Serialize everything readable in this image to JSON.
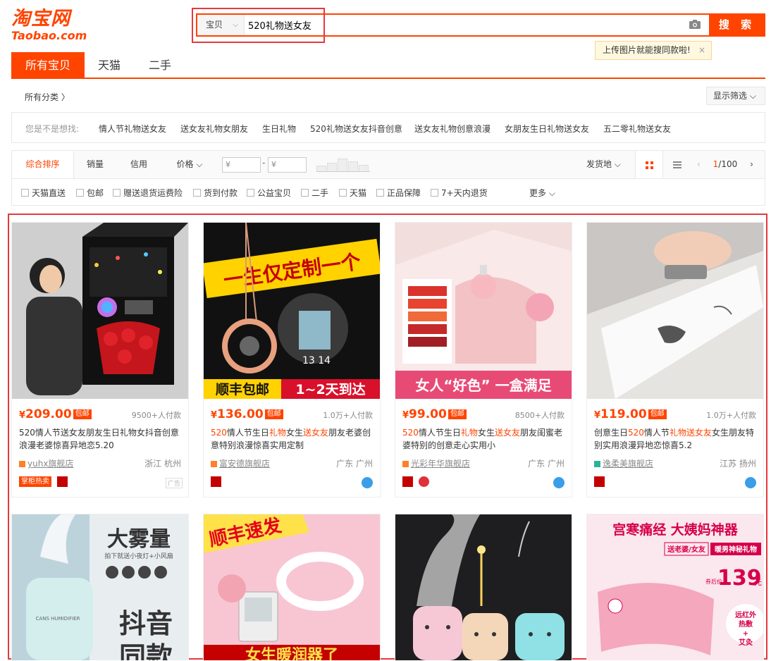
{
  "header": {
    "logo_cn": "淘宝网",
    "logo_en": "Taobao.com",
    "search_type": "宝贝",
    "search_value": "520礼物送女友",
    "search_button": "搜 索",
    "upload_tip": "上传图片就能搜同款啦!",
    "close": "×"
  },
  "tabs": [
    "所有宝贝",
    "天猫",
    "二手"
  ],
  "category": {
    "all": "所有分类 〉",
    "filter_toggle": "显示筛选 ⌵"
  },
  "suggest": {
    "label": "您是不是想找:",
    "items": [
      "情人节礼物送女友",
      "送女友礼物女朋友",
      "生日礼物",
      "520礼物送女友抖音创意",
      "送女友礼物创意浪漫",
      "女朋友生日礼物送女友",
      "五二零礼物送女友"
    ]
  },
  "sort": {
    "items": [
      "综合排序",
      "销量",
      "信用",
      "价格 ⌵"
    ],
    "price_from": "¥",
    "price_to": "¥",
    "dash": "-",
    "ship": "发货地 ⌵",
    "page_current": "1",
    "page_total": "/100"
  },
  "checks": [
    "天猫直送",
    "包邮",
    "赠送退货运费险",
    "货到付款",
    "公益宝贝",
    "二手",
    "天猫",
    "正品保障",
    "7+天内退货"
  ],
  "more": "更多 ⌵",
  "products": [
    {
      "currency": "¥",
      "price": "209.00",
      "post": "包邮",
      "deal": "9500+人付款",
      "title_parts": [
        "520情人节送女友朋友生日礼物女抖音创意浪漫老婆惊喜异地恋5.20"
      ],
      "shop": "yuhx旗舰店",
      "location": "浙江 杭州",
      "tag": "掌柜热卖",
      "ad": "广告"
    },
    {
      "currency": "¥",
      "price": "136.00",
      "post": "包邮",
      "deal": "1.0万+人付款",
      "title_hl1": "520",
      "title_t1": "情人节生日",
      "title_hl2": "礼物",
      "title_t2": "女生",
      "title_hl3": "送女友",
      "title_t3": "朋友老婆创意特别浪漫惊喜实用定制",
      "shop": "富安德旗舰店",
      "location": "广东 广州",
      "image_text_top": "一生仅定制一个",
      "image_text_bottom1": "顺丰包邮",
      "image_text_bottom2": "1~2天到达",
      "image_text_date": "13 14"
    },
    {
      "currency": "¥",
      "price": "99.00",
      "post": "包邮",
      "deal": "8500+人付款",
      "title_hl1": "520",
      "title_t1": "情人节生日",
      "title_hl2": "礼物",
      "title_t2": "女生",
      "title_hl3": "送女友",
      "title_t3": "朋友闺蜜老婆特别的创意走心实用小",
      "shop": "光彩年华旗舰店",
      "location": "广东 广州",
      "image_text_bottom": "女人“好色” 一盒满足"
    },
    {
      "currency": "¥",
      "price": "119.00",
      "post": "包邮",
      "deal": "1.0万+人付款",
      "title_t0": "创意生日",
      "title_hl1": "520",
      "title_t1": "情人节",
      "title_hl2": "礼物送女友",
      "title_t2": "女生朋友特别实用浪漫异地恋惊喜5.2",
      "shop": "逸柔美旗舰店",
      "location": "江苏 扬州"
    }
  ],
  "row2": {
    "p1_big": "大雾量",
    "p1_sub": "拍下就送小夜灯+小风扇",
    "p1_big2": "抖音",
    "p1_big3": "同款",
    "p1_label": "CANS HUMIDIFIER",
    "p2_top": "顺丰速发",
    "p2_bottom": "女生暖润器了",
    "p4_title": "宫寒痛经 大姨妈神器",
    "p4_sub1": "送老婆/女友",
    "p4_sub2": "暖男神秘礼物",
    "p4_price_label": "券后价",
    "p4_price": "139",
    "p4_unit": "元",
    "p4_side1": "远红外",
    "p4_side2": "热敷",
    "p4_side3": "+",
    "p4_side4": "艾灸"
  },
  "colors": {
    "accent": "#ff4400",
    "outline": "#e4393c"
  }
}
